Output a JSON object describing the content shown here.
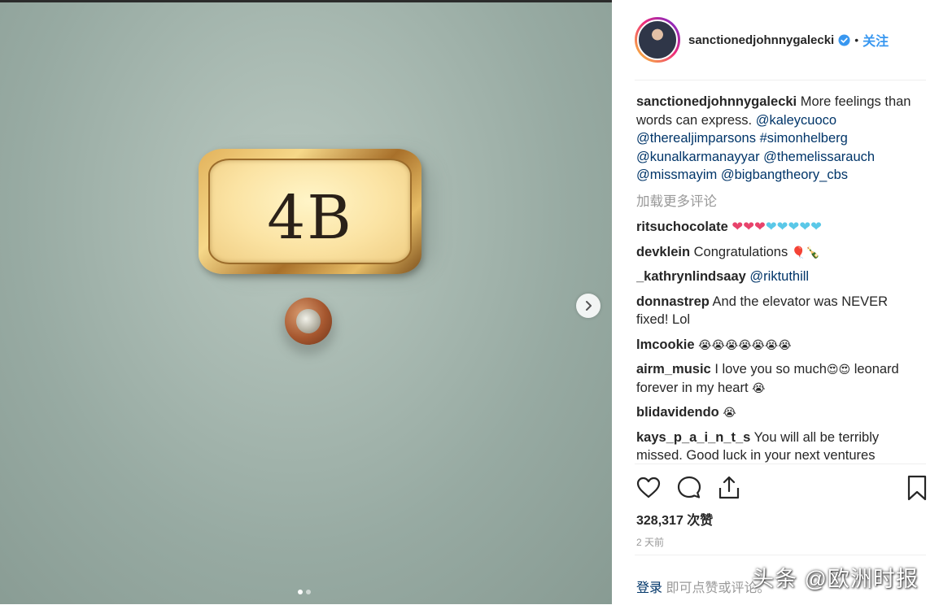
{
  "post": {
    "image_text": "4B",
    "carousel": {
      "count": 2,
      "active_index": 0
    }
  },
  "header": {
    "username": "sanctionedjohnnygalecki",
    "bullet": "•",
    "follow_label": "关注"
  },
  "caption": {
    "username": "sanctionedjohnnygalecki",
    "text": "More feelings than words can express.",
    "mentions": [
      "@kaleycuoco",
      "@therealjimparsons",
      "#simonhelberg",
      "@kunalkarmanayyar",
      "@themelissarauch",
      "@missmayim",
      "@bigbangtheory_cbs"
    ]
  },
  "load_more_label": "加载更多评论",
  "comments": [
    {
      "user": "ritsuchocolate",
      "hearts_red": "❤❤❤",
      "hearts_blue": "❤❤❤❤❤"
    },
    {
      "user": "devklein",
      "text": "Congratulations",
      "emoji": "🎈🍾"
    },
    {
      "user": "_kathrynlindsaay",
      "mention": "@riktuthill"
    },
    {
      "user": "donnastrep",
      "text": "And the elevator was NEVER fixed! Lol"
    },
    {
      "user": "lmcookie",
      "emoji": "😭😭😭😭😭😭😭"
    },
    {
      "user": "airm_music",
      "text_a": "I love you so much",
      "emoji_a": "😍😍",
      "text_b": "leonard forever in my heart",
      "emoji_b": "😭"
    },
    {
      "user": "blidavidendo",
      "emoji": "😭"
    },
    {
      "user": "kays_p_a_i_n_t_s",
      "text": "You will all be terribly missed. Good luck in your next ventures"
    }
  ],
  "icons": [
    "heart-icon",
    "comment-icon",
    "share-icon",
    "bookmark-icon",
    "chevron-right-icon",
    "verified-icon"
  ],
  "likes_label": "328,317 次赞",
  "time_label": "2 天前",
  "footer": {
    "login_label": "登录",
    "suffix": "即可点赞或评论。"
  },
  "watermark": "头条 @欧洲时报",
  "colors": {
    "link": "#003569",
    "follow": "#3897f0",
    "muted": "#999999",
    "verified": "#3897f0"
  }
}
